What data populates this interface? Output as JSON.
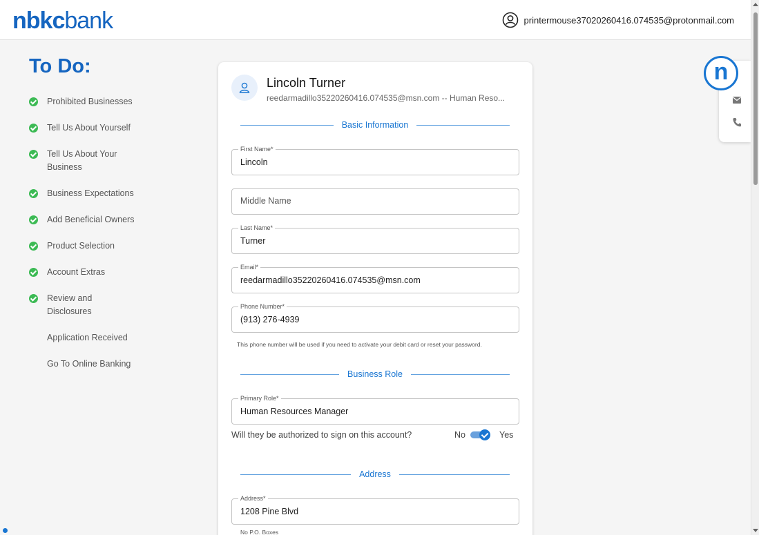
{
  "header": {
    "logo_part1": "nbkc",
    "logo_part2": "bank",
    "user_email": "printermouse37020260416.074535@protonmail.com"
  },
  "todo": {
    "title": "To Do:",
    "items": [
      {
        "label": "Prohibited Businesses",
        "done": true
      },
      {
        "label": "Tell Us About Yourself",
        "done": true
      },
      {
        "label": "Tell Us About Your Business",
        "done": true
      },
      {
        "label": "Business Expectations",
        "done": true
      },
      {
        "label": "Add Beneficial Owners",
        "done": true
      },
      {
        "label": "Product Selection",
        "done": true
      },
      {
        "label": "Account Extras",
        "done": true
      },
      {
        "label": "Review and Disclosures",
        "done": true
      },
      {
        "label": "Application Received",
        "done": false
      },
      {
        "label": "Go To Online Banking",
        "done": false
      }
    ]
  },
  "card": {
    "name": "Lincoln Turner",
    "subline": "reedarmadillo35220260416.074535@msn.com -- Human Reso...",
    "sections": {
      "basic": "Basic Information",
      "role": "Business Role",
      "address": "Address"
    },
    "fields": {
      "first_name": {
        "label": "First Name*",
        "value": "Lincoln"
      },
      "middle_name": {
        "placeholder": "Middle Name",
        "value": ""
      },
      "last_name": {
        "label": "Last Name*",
        "value": "Turner"
      },
      "email": {
        "label": "Email*",
        "value": "reedarmadillo35220260416.074535@msn.com"
      },
      "phone": {
        "label": "Phone Number*",
        "value": "(913) 276-4939"
      },
      "primary_role": {
        "label": "Primary Role*",
        "value": "Human Resources Manager"
      },
      "address": {
        "label": "Address*",
        "value": "1208 Pine Blvd"
      }
    },
    "phone_hint": "This phone number will be used if you need to activate your debit card or reset your password.",
    "authorize": {
      "question": "Will they be authorized to sign on this account?",
      "no": "No",
      "yes": "Yes",
      "value": true
    },
    "address_hint": "No P.O. Boxes"
  },
  "floating": {
    "badge": "n",
    "icons": [
      "mail-icon",
      "phone-icon"
    ]
  },
  "colors": {
    "brand": "#1565c0",
    "accent": "#1976d2",
    "success": "#3cba54"
  }
}
